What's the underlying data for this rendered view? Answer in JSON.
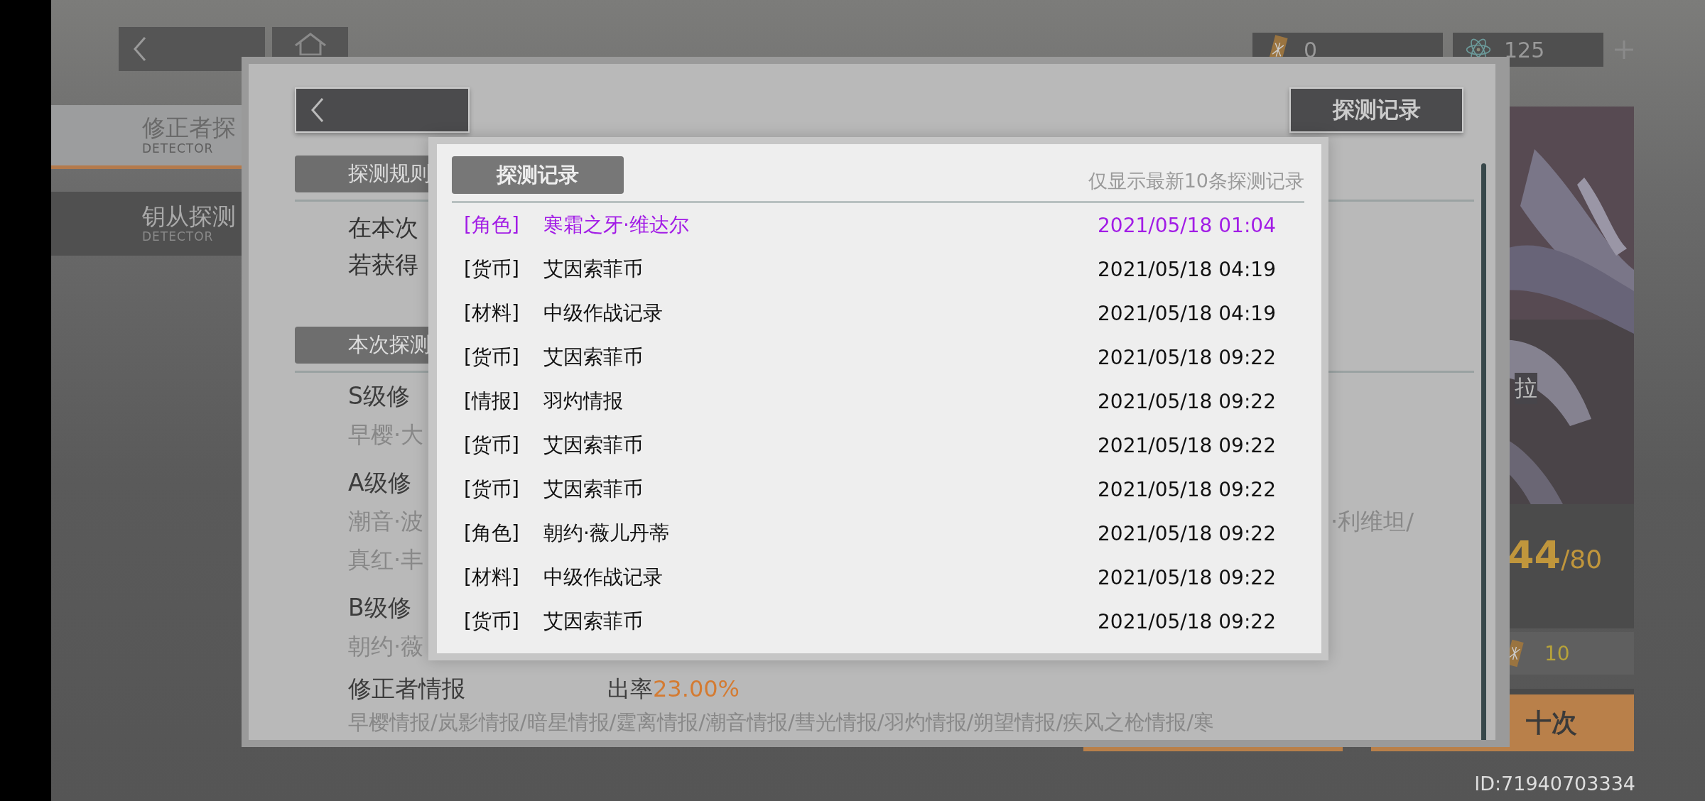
{
  "sidebar": {
    "items": [
      {
        "label": "修正者探",
        "sublabel": "DETECTOR",
        "selected": true
      },
      {
        "label": "钥从探测",
        "sublabel": "DETECTOR",
        "selected": false
      }
    ]
  },
  "currencies": [
    {
      "kind": "ticket",
      "amount": "0"
    },
    {
      "kind": "atom",
      "amount": "125"
    }
  ],
  "featured": {
    "name": "拉",
    "count": "44",
    "total": "/80",
    "cost": "10",
    "button": "十次"
  },
  "player_id": "ID:71940703334",
  "dialog": {
    "record_button": "探测记录",
    "rules": {
      "title": "探测规则",
      "lines": [
        "在本次",
        "若获得"
      ]
    },
    "details": {
      "title": "本次探测",
      "tiers": [
        {
          "name": "S级修",
          "members": [
            {
              "text": "早樱·大"
            }
          ]
        },
        {
          "name": "A级修",
          "members": [
            {
              "text": "潮音·波",
              "tail": "·利维坦/"
            },
            {
              "text": "真红·丰"
            }
          ]
        },
        {
          "name": "B级修",
          "members": [
            {
              "text": "朝约·薇"
            }
          ]
        }
      ],
      "intel": {
        "name": "修正者情报",
        "rate_label": "出率",
        "rate_value": "23.00%",
        "members": "早樱情报/岚影情报/暗星情报/霆离情报/潮音情报/彗光情报/羽灼情报/朔望情报/疾风之枪情报/寒"
      }
    }
  },
  "popup": {
    "title": "探测记录",
    "note": "仅显示最新10条探测记录",
    "rows": [
      {
        "category": "[角色]",
        "item": "寒霜之牙·维达尔",
        "time": "2021/05/18 01:04",
        "color": "#a21ce6"
      },
      {
        "category": "[货币]",
        "item": "艾因索菲币",
        "time": "2021/05/18 04:19",
        "color": "#111111"
      },
      {
        "category": "[材料]",
        "item": "中级作战记录",
        "time": "2021/05/18 04:19",
        "color": "#111111"
      },
      {
        "category": "[货币]",
        "item": "艾因索菲币",
        "time": "2021/05/18 09:22",
        "color": "#111111"
      },
      {
        "category": "[情报]",
        "item": "羽灼情报",
        "time": "2021/05/18 09:22",
        "color": "#111111"
      },
      {
        "category": "[货币]",
        "item": "艾因索菲币",
        "time": "2021/05/18 09:22",
        "color": "#111111"
      },
      {
        "category": "[货币]",
        "item": "艾因索菲币",
        "time": "2021/05/18 09:22",
        "color": "#111111"
      },
      {
        "category": "[角色]",
        "item": "朝约·薇儿丹蒂",
        "time": "2021/05/18 09:22",
        "color": "#111111"
      },
      {
        "category": "[材料]",
        "item": "中级作战记录",
        "time": "2021/05/18 09:22",
        "color": "#111111"
      },
      {
        "category": "[货币]",
        "item": "艾因索菲币",
        "time": "2021/05/18 09:22",
        "color": "#111111"
      }
    ]
  }
}
